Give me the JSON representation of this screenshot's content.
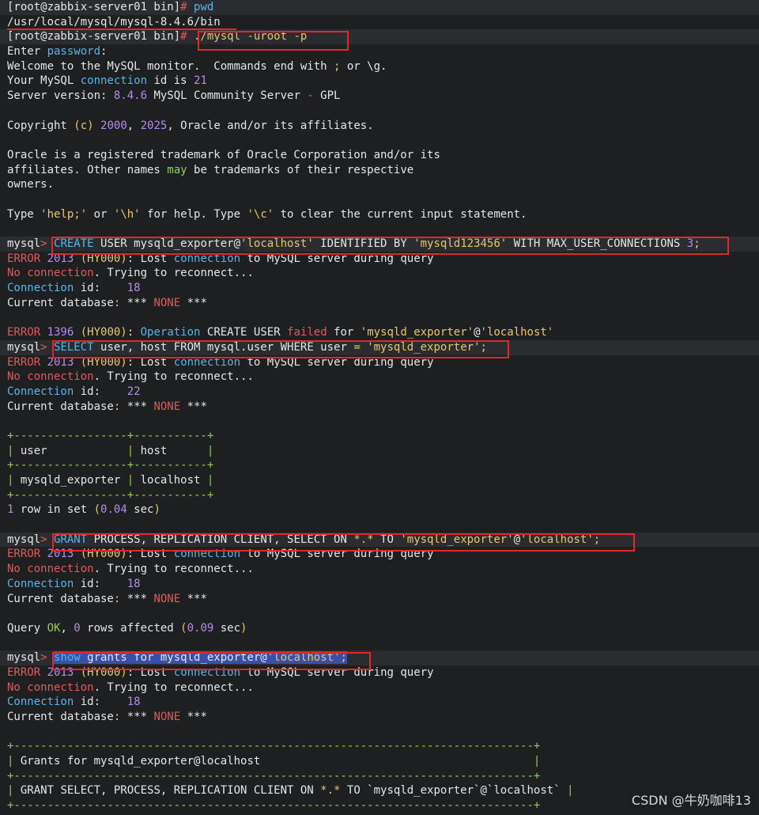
{
  "colors": {
    "default": "#e6e6e6",
    "keyword": "#56b6e6",
    "error": "#e05a5a",
    "number": "#b48cf0",
    "string": "#e7c86a",
    "green": "#8fd14f",
    "box_red": "#e3262b"
  },
  "lines": [
    {
      "hl": true,
      "segs": [
        [
          "[root@zabbix-server01 bin]",
          "default"
        ],
        [
          "# ",
          "error"
        ],
        [
          "pwd",
          "keyword"
        ]
      ]
    },
    {
      "hl": false,
      "segs": [
        [
          "/usr/local/mysql/mysql-8.4.6/bin",
          "default"
        ]
      ]
    },
    {
      "hl": true,
      "segs": [
        [
          "[root@zabbix-server01 bin]",
          "default"
        ],
        [
          "# ",
          "error"
        ],
        [
          "./mysql -uroot -p",
          "string"
        ]
      ]
    },
    {
      "hl": false,
      "segs": [
        [
          "Enter ",
          "default"
        ],
        [
          "password",
          "keyword"
        ],
        [
          ":",
          "default"
        ]
      ]
    },
    {
      "hl": false,
      "segs": [
        [
          "Welcome to the MySQL monitor.  Commands end with ",
          "default"
        ],
        [
          ";",
          "string"
        ],
        [
          " or \\g.",
          "default"
        ]
      ]
    },
    {
      "hl": false,
      "segs": [
        [
          "Your MySQL ",
          "default"
        ],
        [
          "connection",
          "keyword"
        ],
        [
          " id is ",
          "default"
        ],
        [
          "21",
          "number"
        ]
      ]
    },
    {
      "hl": false,
      "segs": [
        [
          "Server version: ",
          "default"
        ],
        [
          "8.4.6",
          "number"
        ],
        [
          " MySQL Community Server ",
          "default"
        ],
        [
          "-",
          "error"
        ],
        [
          " GPL",
          "default"
        ]
      ]
    },
    {
      "hl": false,
      "segs": [
        [
          "",
          "default"
        ]
      ]
    },
    {
      "hl": false,
      "segs": [
        [
          "Copyright ",
          "default"
        ],
        [
          "(c)",
          "string"
        ],
        [
          " ",
          "default"
        ],
        [
          "2000",
          "number"
        ],
        [
          ", ",
          "default"
        ],
        [
          "2025",
          "number"
        ],
        [
          ", Oracle and/or its affiliates.",
          "default"
        ]
      ]
    },
    {
      "hl": false,
      "segs": [
        [
          "",
          "default"
        ]
      ]
    },
    {
      "hl": false,
      "segs": [
        [
          "Oracle is a registered trademark of Oracle Corporation and/or its",
          "default"
        ]
      ]
    },
    {
      "hl": false,
      "segs": [
        [
          "affiliates. Other names ",
          "default"
        ],
        [
          "may",
          "green"
        ],
        [
          " be trademarks of their respective",
          "default"
        ]
      ]
    },
    {
      "hl": false,
      "segs": [
        [
          "owners.",
          "default"
        ]
      ]
    },
    {
      "hl": false,
      "segs": [
        [
          "",
          "default"
        ]
      ]
    },
    {
      "hl": false,
      "segs": [
        [
          "Type ",
          "default"
        ],
        [
          "'help;'",
          "string"
        ],
        [
          " or ",
          "default"
        ],
        [
          "'\\h'",
          "string"
        ],
        [
          " for help. Type ",
          "default"
        ],
        [
          "'\\c'",
          "string"
        ],
        [
          " to clear the current input statement.",
          "default"
        ]
      ]
    },
    {
      "hl": false,
      "segs": [
        [
          "",
          "default"
        ]
      ]
    },
    {
      "hl": true,
      "segs": [
        [
          "mysql",
          "default"
        ],
        [
          "> ",
          "error"
        ],
        [
          "CREATE",
          "keyword"
        ],
        [
          " USER mysqld_exporter@",
          "default"
        ],
        [
          "'localhost'",
          "string"
        ],
        [
          " IDENTIFIED BY ",
          "default"
        ],
        [
          "'mysqld123456'",
          "string"
        ],
        [
          " WITH MAX_USER_CONNECTIONS ",
          "default"
        ],
        [
          "3",
          "number"
        ],
        [
          ";",
          "string"
        ]
      ]
    },
    {
      "hl": false,
      "segs": [
        [
          "ERROR ",
          "error"
        ],
        [
          "2013",
          "number"
        ],
        [
          " ",
          "default"
        ],
        [
          "(HY000)",
          "string"
        ],
        [
          ": Lost ",
          "default"
        ],
        [
          "connection",
          "keyword"
        ],
        [
          " to MySQL server during query",
          "default"
        ]
      ]
    },
    {
      "hl": false,
      "segs": [
        [
          "No connection",
          "error"
        ],
        [
          ". Trying to reconnect...",
          "default"
        ]
      ]
    },
    {
      "hl": false,
      "segs": [
        [
          "Connection",
          "keyword"
        ],
        [
          " id:    ",
          "default"
        ],
        [
          "18",
          "number"
        ]
      ]
    },
    {
      "hl": false,
      "segs": [
        [
          "Current database",
          "default"
        ],
        [
          ":",
          "string"
        ],
        [
          " *** ",
          "default"
        ],
        [
          "NONE",
          "error"
        ],
        [
          " ***",
          "default"
        ]
      ]
    },
    {
      "hl": false,
      "segs": [
        [
          "",
          "default"
        ]
      ]
    },
    {
      "hl": false,
      "segs": [
        [
          "ERROR ",
          "error"
        ],
        [
          "1396",
          "number"
        ],
        [
          " ",
          "default"
        ],
        [
          "(HY000)",
          "string"
        ],
        [
          ": ",
          "default"
        ],
        [
          "Operation",
          "keyword"
        ],
        [
          " CREATE USER ",
          "default"
        ],
        [
          "failed",
          "error"
        ],
        [
          " for ",
          "default"
        ],
        [
          "'mysqld_exporter'",
          "string"
        ],
        [
          "@",
          "default"
        ],
        [
          "'localhost'",
          "string"
        ]
      ]
    },
    {
      "hl": true,
      "segs": [
        [
          "mysql",
          "default"
        ],
        [
          "> ",
          "error"
        ],
        [
          "SELECT",
          "keyword"
        ],
        [
          " user, host FROM mysql.user WHERE user ",
          "default"
        ],
        [
          "=",
          "string"
        ],
        [
          " ",
          "default"
        ],
        [
          "'mysqld_exporter'",
          "string"
        ],
        [
          ";",
          "string"
        ]
      ]
    },
    {
      "hl": false,
      "segs": [
        [
          "ERROR ",
          "error"
        ],
        [
          "2013",
          "number"
        ],
        [
          " ",
          "default"
        ],
        [
          "(HY000)",
          "string"
        ],
        [
          ": Lost ",
          "default"
        ],
        [
          "connection",
          "keyword"
        ],
        [
          " to MySQL server during query",
          "default"
        ]
      ]
    },
    {
      "hl": false,
      "segs": [
        [
          "No connection",
          "error"
        ],
        [
          ". Trying to reconnect...",
          "default"
        ]
      ]
    },
    {
      "hl": false,
      "segs": [
        [
          "Connection",
          "keyword"
        ],
        [
          " id:    ",
          "default"
        ],
        [
          "22",
          "number"
        ]
      ]
    },
    {
      "hl": false,
      "segs": [
        [
          "Current database",
          "default"
        ],
        [
          ":",
          "string"
        ],
        [
          " *** ",
          "default"
        ],
        [
          "NONE",
          "error"
        ],
        [
          " ***",
          "default"
        ]
      ]
    },
    {
      "hl": false,
      "segs": [
        [
          "",
          "default"
        ]
      ]
    },
    {
      "hl": false,
      "segs": [
        [
          "+-----------------+-----------+",
          "green"
        ]
      ]
    },
    {
      "hl": false,
      "segs": [
        [
          "|",
          "green"
        ],
        [
          " user            ",
          "default"
        ],
        [
          "|",
          "green"
        ],
        [
          " host      ",
          "default"
        ],
        [
          "|",
          "green"
        ]
      ]
    },
    {
      "hl": false,
      "segs": [
        [
          "+-----------------+-----------+",
          "green"
        ]
      ]
    },
    {
      "hl": false,
      "segs": [
        [
          "|",
          "green"
        ],
        [
          " mysqld_exporter ",
          "default"
        ],
        [
          "|",
          "green"
        ],
        [
          " localhost ",
          "default"
        ],
        [
          "|",
          "green"
        ]
      ]
    },
    {
      "hl": false,
      "segs": [
        [
          "+-----------------+-----------+",
          "green"
        ]
      ]
    },
    {
      "hl": false,
      "segs": [
        [
          "1",
          "number"
        ],
        [
          " row in set ",
          "default"
        ],
        [
          "(",
          "string"
        ],
        [
          "0.04",
          "number"
        ],
        [
          " sec",
          "default"
        ],
        [
          ")",
          "string"
        ]
      ]
    },
    {
      "hl": false,
      "segs": [
        [
          "",
          "default"
        ]
      ]
    },
    {
      "hl": true,
      "segs": [
        [
          "mysql",
          "default"
        ],
        [
          "> ",
          "error"
        ],
        [
          "GRANT",
          "keyword"
        ],
        [
          " PROCESS, REPLICATION CLIENT, SELECT ON ",
          "default"
        ],
        [
          "*.*",
          "string"
        ],
        [
          " TO ",
          "default"
        ],
        [
          "'mysqld_exporter'",
          "string"
        ],
        [
          "@",
          "default"
        ],
        [
          "'localhost'",
          "string"
        ],
        [
          ";",
          "string"
        ]
      ]
    },
    {
      "hl": false,
      "segs": [
        [
          "ERROR ",
          "error"
        ],
        [
          "2013",
          "number"
        ],
        [
          " ",
          "default"
        ],
        [
          "(HY000)",
          "string"
        ],
        [
          ": Lost ",
          "default"
        ],
        [
          "connection",
          "keyword"
        ],
        [
          " to MySQL server during query",
          "default"
        ]
      ]
    },
    {
      "hl": false,
      "segs": [
        [
          "No connection",
          "error"
        ],
        [
          ". Trying to reconnect...",
          "default"
        ]
      ]
    },
    {
      "hl": false,
      "segs": [
        [
          "Connection",
          "keyword"
        ],
        [
          " id:    ",
          "default"
        ],
        [
          "18",
          "number"
        ]
      ]
    },
    {
      "hl": false,
      "segs": [
        [
          "Current database",
          "default"
        ],
        [
          ":",
          "string"
        ],
        [
          " *** ",
          "default"
        ],
        [
          "NONE",
          "error"
        ],
        [
          " ***",
          "default"
        ]
      ]
    },
    {
      "hl": false,
      "segs": [
        [
          "",
          "default"
        ]
      ]
    },
    {
      "hl": false,
      "segs": [
        [
          "Query ",
          "default"
        ],
        [
          "OK",
          "green"
        ],
        [
          ", ",
          "default"
        ],
        [
          "0",
          "number"
        ],
        [
          " rows affected ",
          "default"
        ],
        [
          "(",
          "string"
        ],
        [
          "0.09",
          "number"
        ],
        [
          " sec",
          "default"
        ],
        [
          ")",
          "string"
        ]
      ]
    },
    {
      "hl": false,
      "segs": [
        [
          "",
          "default"
        ]
      ]
    },
    {
      "hl": true,
      "segs": [
        [
          "mysql",
          "default"
        ],
        [
          "> ",
          "error"
        ],
        [
          "show",
          "keyword",
          "sel"
        ],
        [
          " grants for mysqld_exporter@",
          "default",
          "sel"
        ],
        [
          "'localhost'",
          "string",
          "sel"
        ],
        [
          ";",
          "string",
          "sel"
        ]
      ]
    },
    {
      "hl": false,
      "segs": [
        [
          "ERROR ",
          "error"
        ],
        [
          "2013",
          "number"
        ],
        [
          " ",
          "default"
        ],
        [
          "(HY000)",
          "string"
        ],
        [
          ": Lost ",
          "default"
        ],
        [
          "connection",
          "keyword"
        ],
        [
          " to MySQL server during query",
          "default"
        ]
      ]
    },
    {
      "hl": false,
      "segs": [
        [
          "No connection",
          "error"
        ],
        [
          ". Trying to reconnect...",
          "default"
        ]
      ]
    },
    {
      "hl": false,
      "segs": [
        [
          "Connection",
          "keyword"
        ],
        [
          " id:    ",
          "default"
        ],
        [
          "18",
          "number"
        ]
      ]
    },
    {
      "hl": false,
      "segs": [
        [
          "Current database",
          "default"
        ],
        [
          ":",
          "string"
        ],
        [
          " *** ",
          "default"
        ],
        [
          "NONE",
          "error"
        ],
        [
          " ***",
          "default"
        ]
      ]
    },
    {
      "hl": false,
      "segs": [
        [
          "",
          "default"
        ]
      ]
    },
    {
      "hl": false,
      "segs": [
        [
          "+------------------------------------------------------------------------------+",
          "green"
        ]
      ]
    },
    {
      "hl": false,
      "segs": [
        [
          "|",
          "green"
        ],
        [
          " Grants for mysqld_exporter@localhost                                         ",
          "default"
        ],
        [
          "|",
          "green"
        ]
      ]
    },
    {
      "hl": false,
      "segs": [
        [
          "+------------------------------------------------------------------------------+",
          "green"
        ]
      ]
    },
    {
      "hl": false,
      "segs": [
        [
          "|",
          "green"
        ],
        [
          " GRANT SELECT, PROCESS, REPLICATION CLIENT ON ",
          "default"
        ],
        [
          "*.*",
          "string"
        ],
        [
          " TO `mysqld_exporter`@`localhost` ",
          "default"
        ],
        [
          "|",
          "green"
        ]
      ]
    },
    {
      "hl": false,
      "segs": [
        [
          "+------------------------------------------------------------------------------+",
          "green"
        ]
      ]
    }
  ],
  "watermark": "CSDN @牛奶咖啡13"
}
